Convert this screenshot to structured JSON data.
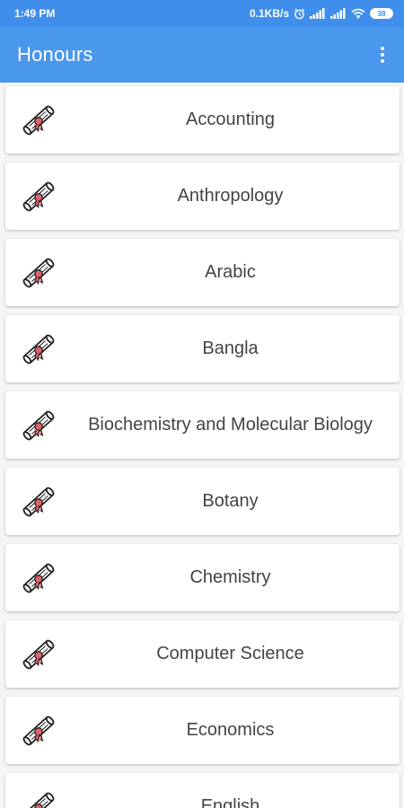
{
  "status_bar": {
    "time": "1:49 PM",
    "network_speed": "0.1KB/s",
    "battery": "38"
  },
  "app_bar": {
    "title": "Honours",
    "menu_icon": "more-vert-icon"
  },
  "colors": {
    "status_bar": "#3f8eeb",
    "app_bar": "#4a97ee",
    "background": "#f5f5f5"
  },
  "subjects": [
    {
      "label": "Accounting",
      "icon": "diploma-scroll-icon"
    },
    {
      "label": "Anthropology",
      "icon": "diploma-scroll-icon"
    },
    {
      "label": "Arabic",
      "icon": "diploma-scroll-icon"
    },
    {
      "label": "Bangla",
      "icon": "diploma-scroll-icon"
    },
    {
      "label": "Biochemistry and Molecular Biology",
      "icon": "diploma-scroll-icon"
    },
    {
      "label": "Botany",
      "icon": "diploma-scroll-icon"
    },
    {
      "label": "Chemistry",
      "icon": "diploma-scroll-icon"
    },
    {
      "label": "Computer Science",
      "icon": "diploma-scroll-icon"
    },
    {
      "label": "Economics",
      "icon": "diploma-scroll-icon"
    },
    {
      "label": "English",
      "icon": "diploma-scroll-icon"
    }
  ]
}
